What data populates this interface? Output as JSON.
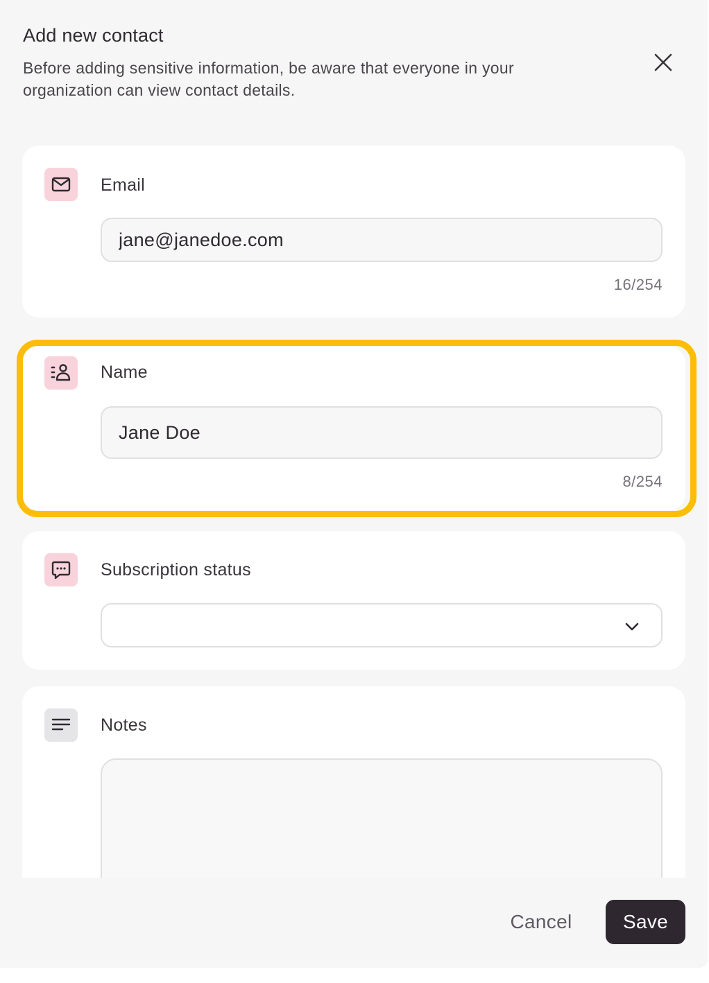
{
  "dialog": {
    "title": "Add new contact",
    "description": "Before adding sensitive information, be aware that everyone in your organization can view contact details."
  },
  "fields": {
    "email": {
      "label": "Email",
      "value": "jane@janedoe.com",
      "counter": "16/254",
      "icon": "envelope-icon"
    },
    "name": {
      "label": "Name",
      "value": "Jane Doe",
      "counter": "8/254",
      "icon": "contact-person-icon",
      "highlighted": true
    },
    "subscription_status": {
      "label": "Subscription status",
      "value": "",
      "icon": "chat-bubble-icon"
    },
    "notes": {
      "label": "Notes",
      "value": "",
      "icon": "text-lines-icon"
    }
  },
  "footer": {
    "cancel_label": "Cancel",
    "save_label": "Save"
  },
  "colors": {
    "highlight": "#fbbd08",
    "icon_pink_bg": "#f9d3db",
    "primary_button": "#2f2730"
  }
}
